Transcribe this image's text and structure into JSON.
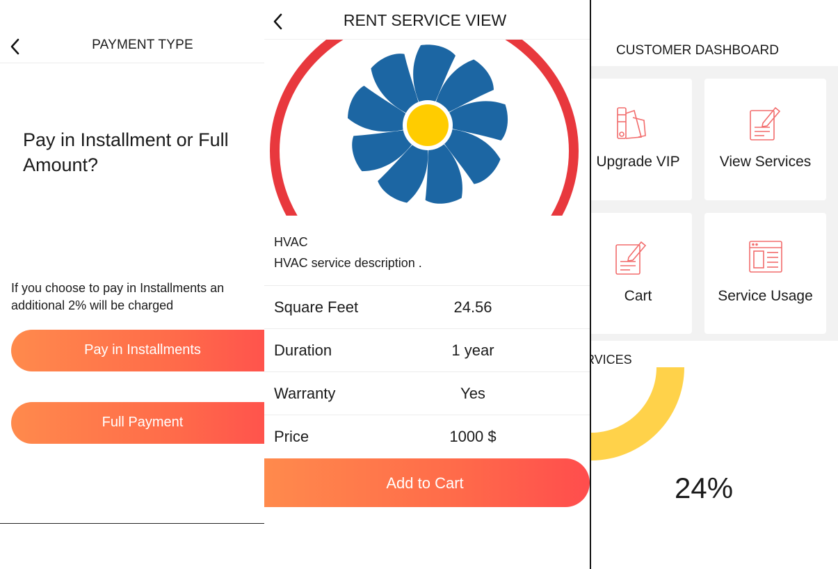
{
  "payment_type": {
    "title": "PAYMENT TYPE",
    "question": "Pay in Installment or Full Amount?",
    "note": "If you choose to pay in Installments an additional 2% will be charged",
    "installments_button": "Pay in Installments",
    "full_payment_button": "Full Payment"
  },
  "rent_service": {
    "title": "RENT SERVICE VIEW",
    "service_name": "HVAC",
    "service_description": "HVAC service description .",
    "details": [
      {
        "label": "Square Feet",
        "value": "24.56"
      },
      {
        "label": "Duration",
        "value": "1 year"
      },
      {
        "label": "Warranty",
        "value": "Yes"
      },
      {
        "label": "Price",
        "value": "1000 $"
      }
    ],
    "add_to_cart_button": "Add to Cart"
  },
  "dashboard": {
    "title": "CUSTOMER DASHBOARD",
    "cards": [
      {
        "label": "Upgrade VIP",
        "icon": "palette-icon"
      },
      {
        "label": "View Services",
        "icon": "edit-document-icon"
      },
      {
        "label": "Cart",
        "icon": "edit-document-icon"
      },
      {
        "label": "Service Usage",
        "icon": "layout-icon"
      }
    ],
    "section_label": "RVICES",
    "usage_percent_label": "24%",
    "usage_percent": 24
  },
  "colors": {
    "gradient_start": "#ff8a4c",
    "gradient_end": "#ff4d4d",
    "icon_accent": "#f26b6b",
    "fan_blue": "#1c66a3",
    "fan_center": "#ffcc00",
    "ring_red": "#e8383d",
    "donut_yellow": "#ffd24a"
  }
}
